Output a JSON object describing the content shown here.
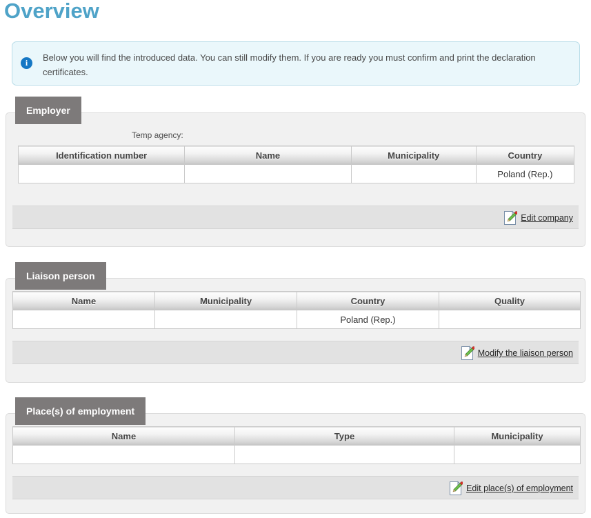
{
  "page": {
    "title": "Overview"
  },
  "info": {
    "icon": "info-circle-icon",
    "text": "Below you will find the introduced data. You can still modify them. If you are ready you must confirm and print the declaration certificates."
  },
  "sections": [
    {
      "legend": "Employer",
      "sub_label": "Temp agency:",
      "columns": [
        "Identification number",
        "Name",
        "Municipality",
        "Country"
      ],
      "rows": [
        [
          "",
          "",
          "",
          "Poland (Rep.)"
        ]
      ],
      "action": {
        "label": "Edit company",
        "icon": "edit-pencil-icon"
      }
    },
    {
      "legend": "Liaison person",
      "sub_label": "",
      "columns": [
        "Name",
        "Municipality",
        "Country",
        "Quality"
      ],
      "rows": [
        [
          "",
          "",
          "Poland (Rep.)",
          ""
        ]
      ],
      "action": {
        "label": "Modify the liaison person",
        "icon": "edit-pencil-icon"
      }
    },
    {
      "legend": "Place(s) of employment",
      "sub_label": "",
      "columns": [
        "Name",
        "Type",
        "Municipality"
      ],
      "rows": [
        [
          "",
          "",
          ""
        ]
      ],
      "action": {
        "label": "Edit place(s) of employment",
        "icon": "edit-pencil-icon"
      }
    }
  ],
  "colors": {
    "title": "#4fa3c8",
    "legend_bg": "#7d7a7a",
    "info_bg": "#eaf7fb",
    "info_border": "#b8dce8",
    "panel_bg": "#f1f1f1",
    "action_bar_bg": "#e2e2e2"
  }
}
